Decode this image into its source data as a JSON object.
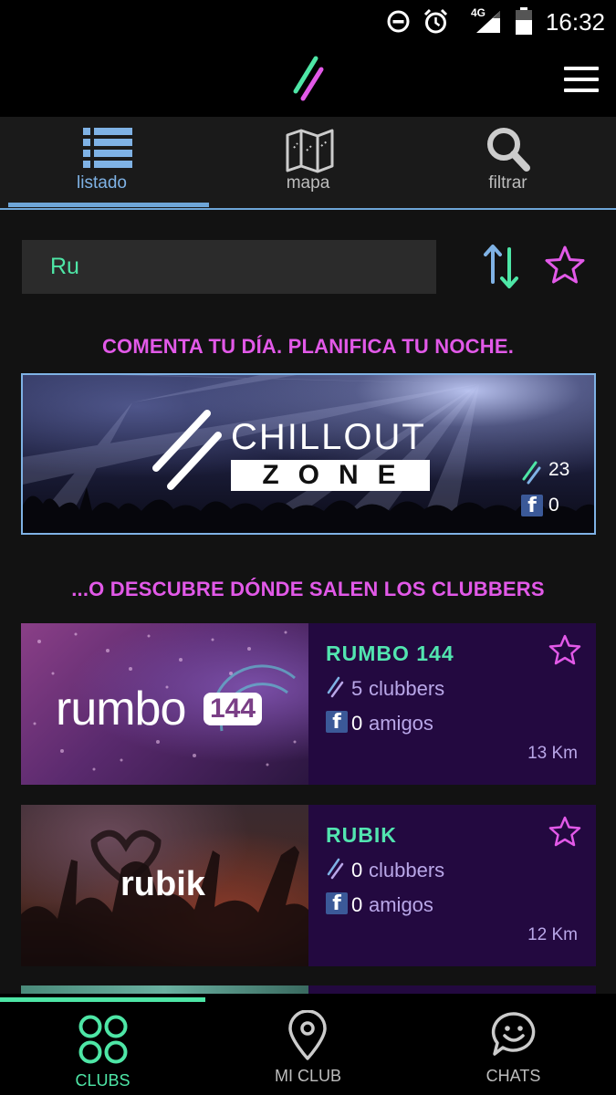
{
  "status_bar": {
    "time": "16:32",
    "network": "4G",
    "icons": [
      "do-not-disturb-icon",
      "alarm-icon",
      "signal-icon",
      "battery-icon"
    ]
  },
  "app_bar": {
    "logo": "app-logo-slashes",
    "menu_icon": "hamburger-menu-icon"
  },
  "tabs": [
    {
      "label": "listado",
      "icon": "list-icon",
      "active": true
    },
    {
      "label": "mapa",
      "icon": "map-icon",
      "active": false
    },
    {
      "label": "filtrar",
      "icon": "search-icon",
      "active": false
    }
  ],
  "search": {
    "value": "Ru",
    "placeholder": ""
  },
  "actions": {
    "sort_icon": "sort-arrows-icon",
    "favorites_icon": "star-outline-icon"
  },
  "headings": {
    "top": "COMENTA TU DÍA. PLANIFICA TU NOCHE.",
    "middle": "...O DESCUBRE DÓNDE SALEN LOS CLUBBERS"
  },
  "banner": {
    "title_top": "CHILLOUT",
    "title_bottom": "ZONE",
    "clubbers": "23",
    "friends": "0"
  },
  "clubs": [
    {
      "name": "RUMBO 144",
      "image_text": "rumbo",
      "image_badge": "144",
      "clubbers_count": "5",
      "clubbers_label": "clubbers",
      "friends_count": "0",
      "friends_label": "amigos",
      "distance": "13 Km"
    },
    {
      "name": "RUBIK",
      "image_text": "rubik",
      "clubbers_count": "0",
      "clubbers_label": "clubbers",
      "friends_count": "0",
      "friends_label": "amigos",
      "distance": "12 Km"
    }
  ],
  "bottom_nav": [
    {
      "label": "CLUBS",
      "icon": "clubs-grid-icon",
      "active": true
    },
    {
      "label": "MI CLUB",
      "icon": "location-pin-icon",
      "active": false
    },
    {
      "label": "CHATS",
      "icon": "chat-smiley-icon",
      "active": false
    }
  ],
  "colors": {
    "accent_green": "#4ee6a6",
    "accent_pink": "#e259e8",
    "accent_blue": "#7fb2e5",
    "card_purple": "#230940"
  }
}
